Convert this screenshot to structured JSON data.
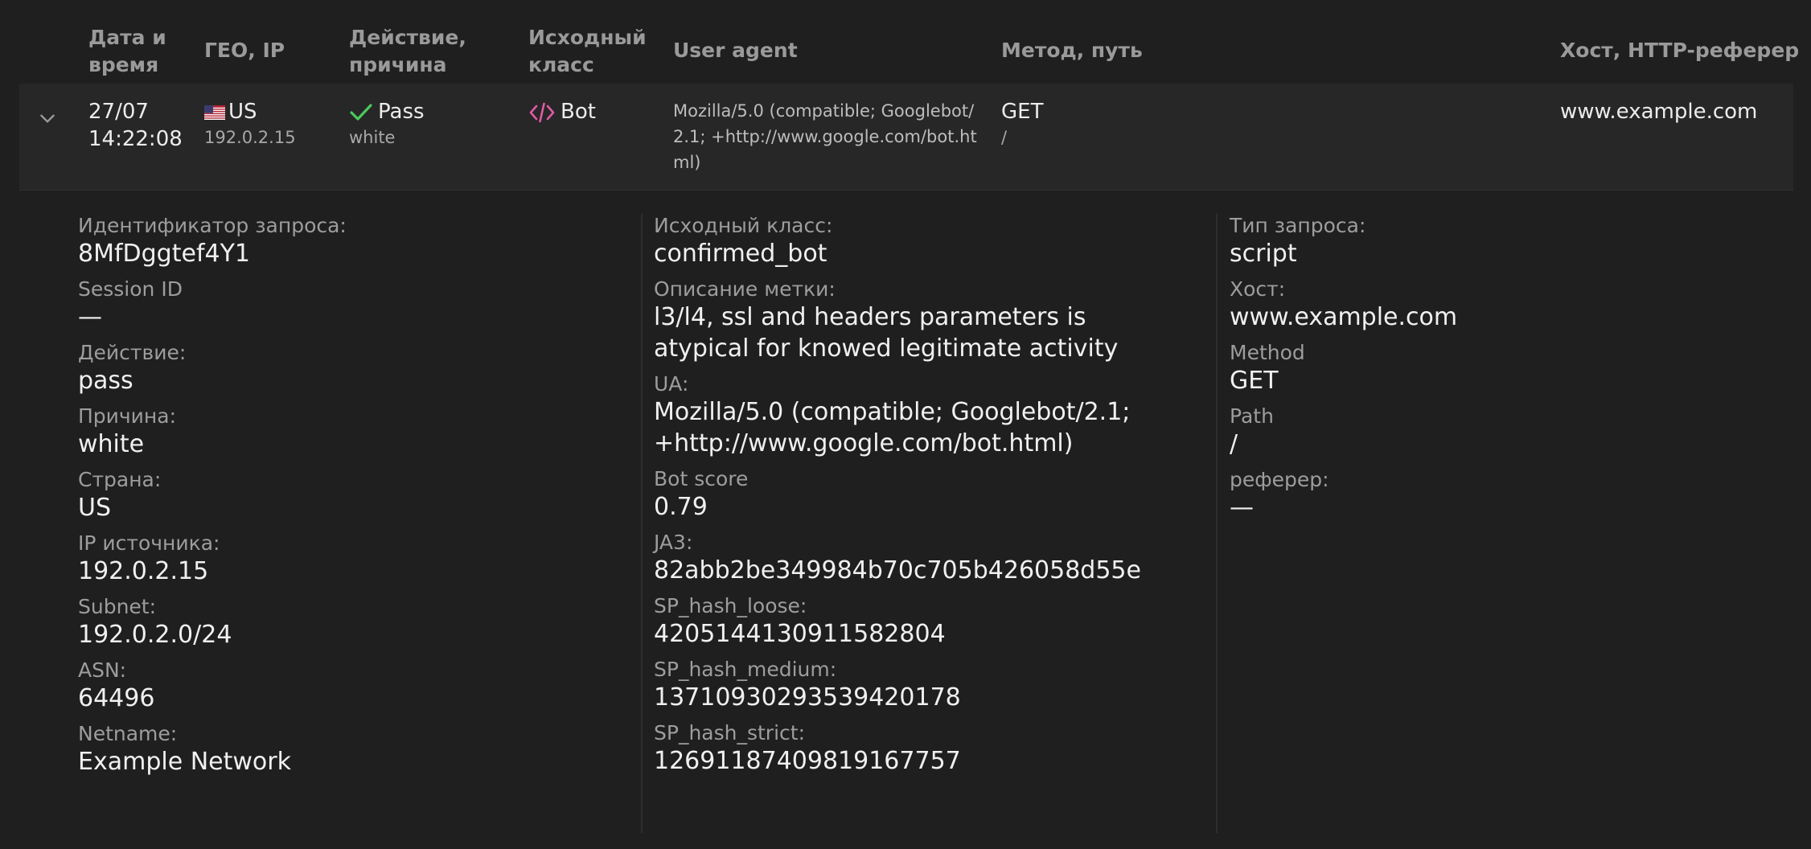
{
  "columns": {
    "datetime": [
      "Дата и",
      "время"
    ],
    "geo": "ГЕО, IP",
    "action": [
      "Действие,",
      "причина"
    ],
    "source_class": [
      "Исходный",
      "класс"
    ],
    "user_agent": "User agent",
    "method": "Метод, путь",
    "host": "Хост, HTTP-реферер"
  },
  "row": {
    "date": "27/07",
    "time": "14:22:08",
    "country": "US",
    "ip": "192.0.2.15",
    "action": "Pass",
    "reason": "white",
    "class": "Bot",
    "ua": "Mozilla/5.0 (compatible; Googlebot/2.1; +http://www.google.com/bot.html)",
    "method": "GET",
    "path": "/",
    "host": "www.example.com"
  },
  "details": {
    "col1": [
      {
        "label": "Идентификатор запроса:",
        "value": "8MfDggtef4Y1"
      },
      {
        "label": "Session ID",
        "value": "—"
      },
      {
        "label": "Действие:",
        "value": "pass"
      },
      {
        "label": "Причина:",
        "value": "white"
      },
      {
        "label": "Страна:",
        "value": "US"
      },
      {
        "label": "IP источника:",
        "value": "192.0.2.15"
      },
      {
        "label": "Subnet:",
        "value": "192.0.2.0/24"
      },
      {
        "label": "ASN:",
        "value": "64496"
      },
      {
        "label": "Netname:",
        "value": "Example Network"
      }
    ],
    "col2": [
      {
        "label": "Исходный класс:",
        "value": "confirmed_bot"
      },
      {
        "label": "Описание метки:",
        "value": "l3/l4, ssl and headers parameters is atypical for knowed legitimate activity"
      },
      {
        "label": "UA:",
        "value": "Mozilla/5.0 (compatible; Googlebot/2.1; +http://www.google.com/bot.html)"
      },
      {
        "label": "Bot score",
        "value": "0.79"
      },
      {
        "label": "JA3:",
        "value": "82abb2be349984b70c705b426058d55e"
      },
      {
        "label": "SP_hash_loose:",
        "value": "4205144130911582804"
      },
      {
        "label": "SP_hash_medium:",
        "value": "13710930293539420178"
      },
      {
        "label": "SP_hash_strict:",
        "value": "12691187409819167757"
      }
    ],
    "col3": [
      {
        "label": "Тип запроса:",
        "value": "script"
      },
      {
        "label": "Хост:",
        "value": "www.example.com"
      },
      {
        "label": "Method",
        "value": "GET"
      },
      {
        "label": "Path",
        "value": "/"
      },
      {
        "label": "реферер:",
        "value": "—"
      }
    ]
  },
  "colors": {
    "background": "#1f1f1f",
    "row_background": "#272727",
    "pass_icon": "#4cc95c",
    "bot_icon": "#e05aa6"
  },
  "icons": {
    "expand": "chevron-down-icon",
    "flag": "us-flag-icon",
    "pass": "check-icon",
    "bot": "code-icon"
  }
}
